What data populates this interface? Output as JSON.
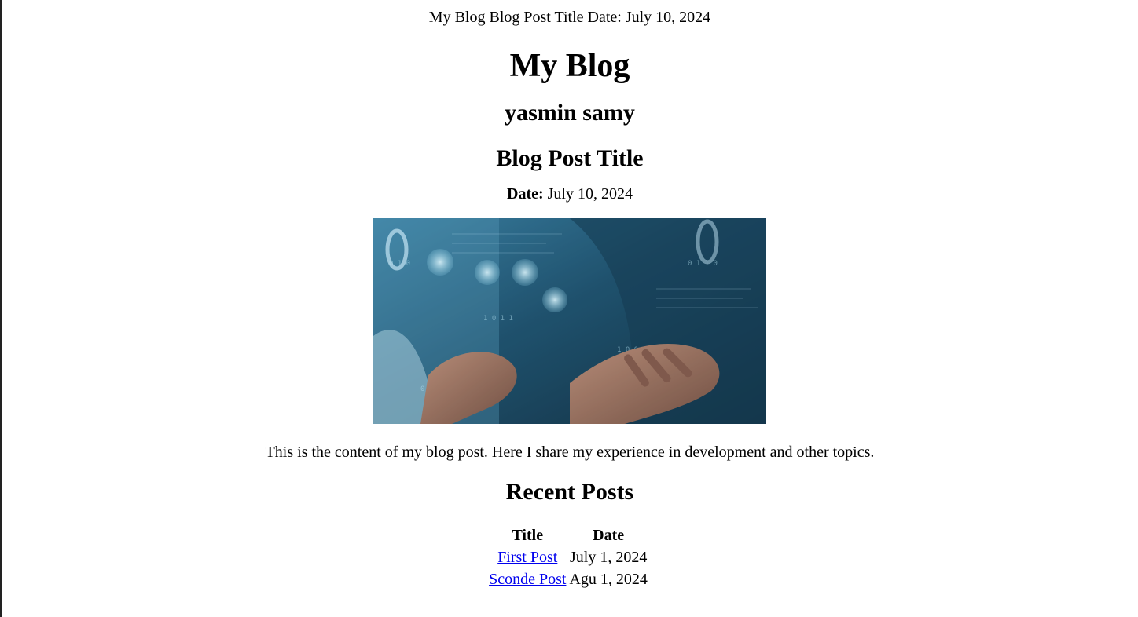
{
  "header": {
    "top_line": "My Blog Blog Post Title Date: July 10, 2024",
    "blog_title": "My Blog",
    "author": "yasmin samy"
  },
  "post": {
    "title": "Blog Post Title",
    "date_label": "Date:",
    "date_value": " July 10, 2024",
    "image_alt": "Hands typing on a laptop with digital code overlay",
    "content": "This is the content of my blog post. Here I share my experience in development and other topics."
  },
  "recent": {
    "heading": "Recent Posts",
    "columns": [
      "Title",
      "Date"
    ],
    "rows": [
      {
        "title": "First Post",
        "date": "July 1, 2024"
      },
      {
        "title": "Sconde Post",
        "date": "Agu 1, 2024"
      }
    ]
  },
  "colors": {
    "link": "#0000ee",
    "text": "#000000",
    "background": "#ffffff"
  }
}
